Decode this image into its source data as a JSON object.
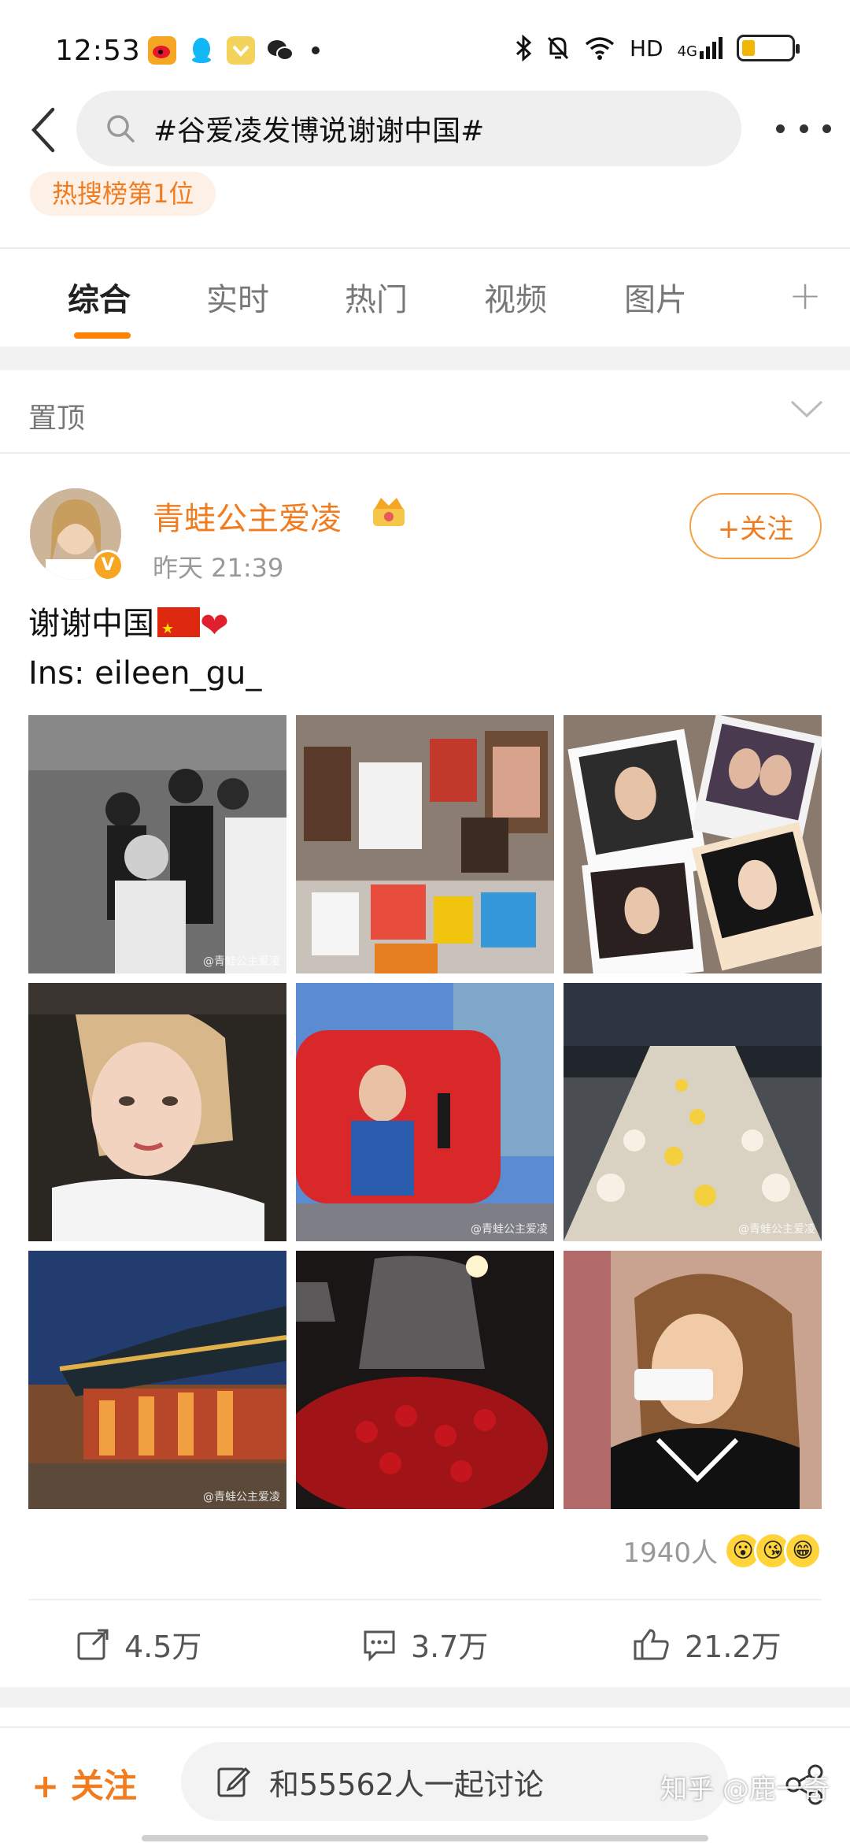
{
  "status_bar": {
    "time": "12:53",
    "network": "HD",
    "signal": "4G"
  },
  "search": {
    "query": "#谷爱凌发博说谢谢中国#"
  },
  "hot_badge": "热搜榜第1位",
  "tabs": [
    {
      "label": "综合",
      "active": true
    },
    {
      "label": "实时",
      "active": false
    },
    {
      "label": "热门",
      "active": false
    },
    {
      "label": "视频",
      "active": false
    },
    {
      "label": "图片",
      "active": false
    }
  ],
  "tab_add": "+",
  "pinned": {
    "label": "置顶"
  },
  "post": {
    "author": "青蛙公主爱凌",
    "time": "昨天 21:39",
    "follow_label": "+关注",
    "text_line1": "谢谢中国",
    "text_line2": "Ins: eileen_gu_",
    "photo_watermark": "@青蛙公主爱凌",
    "reaction_count": "1940人",
    "reposts": "4.5万",
    "comments": "3.7万",
    "likes": "21.2万"
  },
  "bottom": {
    "follow": "+ 关注",
    "comment_placeholder": "和55562人一起讨论",
    "watermark": "知乎 @鹿一奇"
  },
  "colors": {
    "accent": "#ff8200",
    "author": "#f07c1f"
  },
  "icons": [
    "back-arrow-icon",
    "search-icon",
    "more-dots-icon",
    "chevron-down-icon",
    "crown-icon",
    "verified-icon",
    "repost-icon",
    "comment-icon",
    "like-icon",
    "edit-icon",
    "share-icon"
  ]
}
